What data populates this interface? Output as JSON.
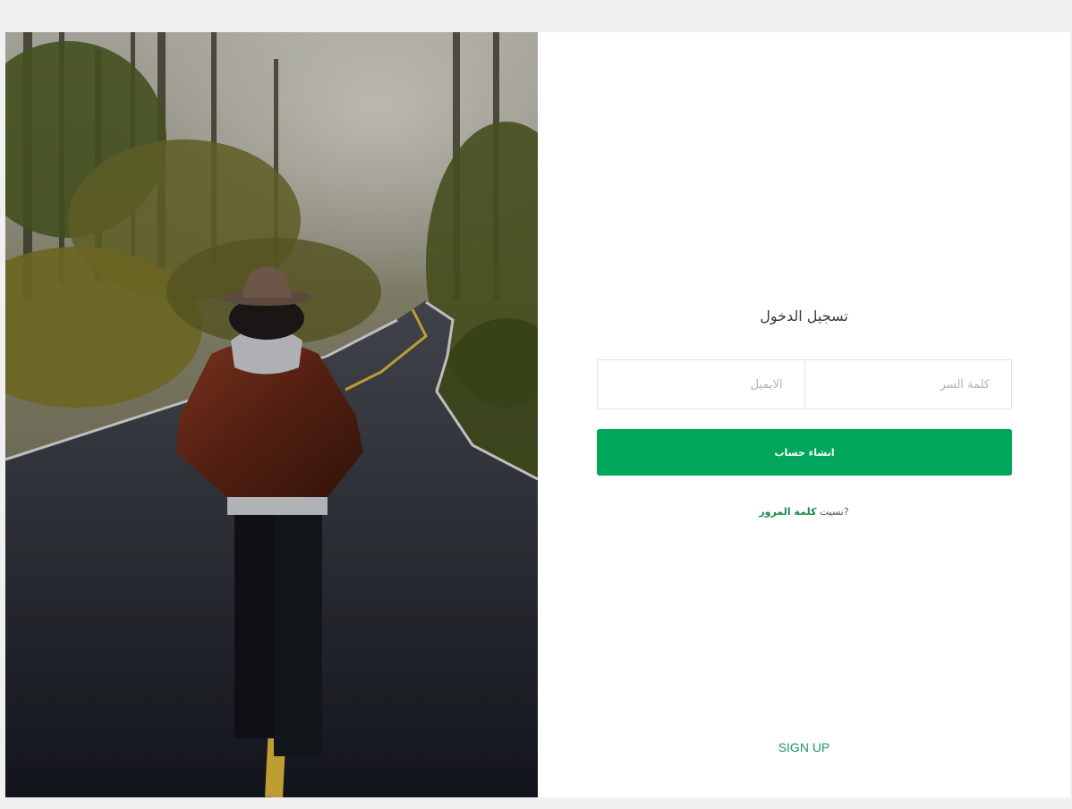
{
  "hero": {
    "image": "person-walking-forest-road"
  },
  "login": {
    "title": "تسجيل الدخول",
    "email_placeholder": "الايميل",
    "password_placeholder": "كلمة السر",
    "submit_label": "انشاء حساب",
    "forgot_prefix": "?نسيت",
    "forgot_link": "كلمة المرور",
    "signup_label": "SIGN UP"
  },
  "colors": {
    "accent": "#00a65a",
    "link": "#1a9a5a",
    "background": "#f0f0f0"
  }
}
